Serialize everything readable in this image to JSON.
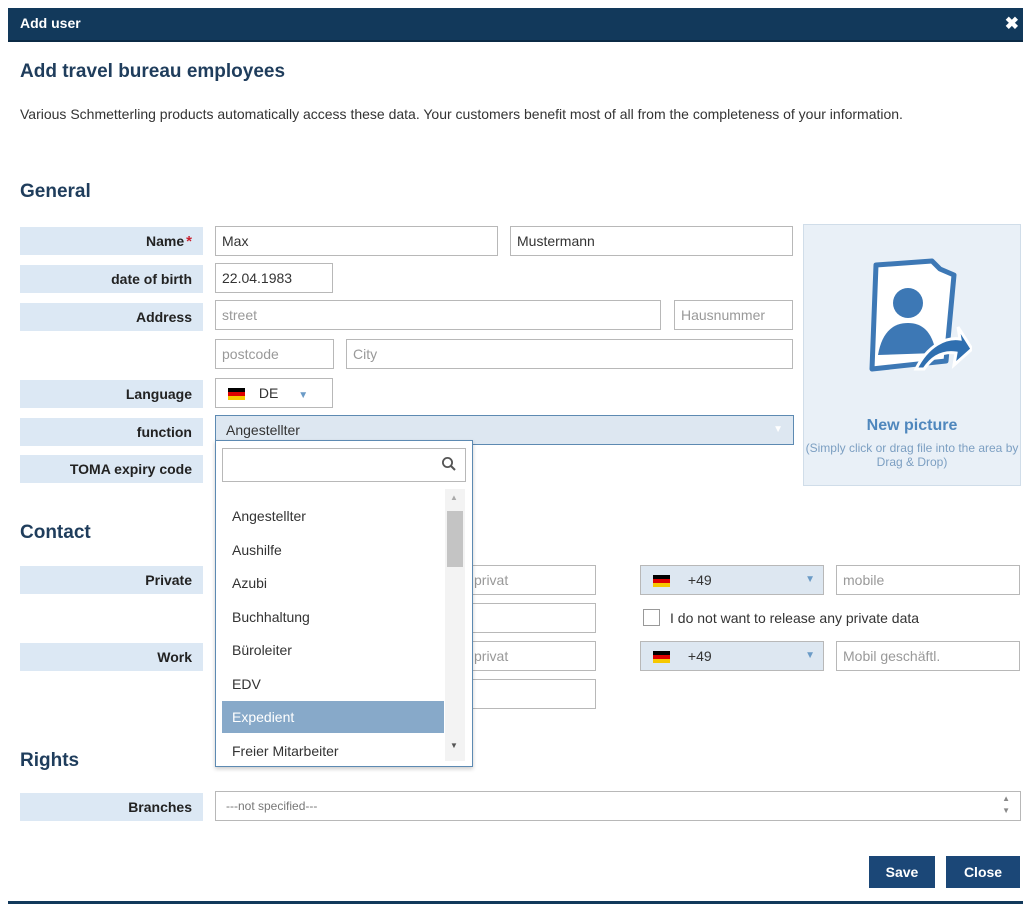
{
  "dialog": {
    "title": "Add user",
    "close_glyph": "✖"
  },
  "page": {
    "heading": "Add travel bureau employees",
    "description": "Various Schmetterling products automatically access these data. Your customers benefit most of all from the completeness of your information."
  },
  "general": {
    "heading": "General",
    "name": {
      "label": "Name",
      "required_mark": "*",
      "first": "Max",
      "last": "Mustermann"
    },
    "dob": {
      "label": "date of birth",
      "value": "22.04.1983"
    },
    "address": {
      "label": "Address",
      "street_placeholder": "street",
      "number_placeholder": "Hausnummer",
      "postcode_placeholder": "postcode",
      "city_placeholder": "City"
    },
    "language": {
      "label": "Language",
      "value": "DE"
    },
    "function": {
      "label": "function",
      "value": "Angestellter"
    },
    "toma": {
      "label": "TOMA expiry code"
    }
  },
  "picture": {
    "title": "New picture",
    "subtitle": "(Simply click or drag file into the area by Drag & Drop)"
  },
  "function_dropdown": {
    "search_value": "",
    "options": [
      "Angestellter",
      "Aushilfe",
      "Azubi",
      "Buchhaltung",
      "Büroleiter",
      "EDV",
      "Expedient",
      "Freier Mitarbeiter"
    ],
    "selected": "Expedient"
  },
  "contact": {
    "heading": "Contact",
    "private": {
      "label": "Private",
      "phone_placeholder": "privat",
      "country_code": "+49",
      "mobile_placeholder": "mobile"
    },
    "no_private_label": "I do not want to release any private data",
    "work": {
      "label": "Work",
      "phone_placeholder": "privat",
      "country_code": "+49",
      "mobile_placeholder": "Mobil geschäftl."
    }
  },
  "rights": {
    "heading": "Rights",
    "branches": {
      "label": "Branches",
      "value": "---not specified---"
    }
  },
  "buttons": {
    "save": "Save",
    "close": "Close"
  },
  "colors": {
    "accent": "#1b4777",
    "label_bg": "#dce8f4",
    "required": "#c8202f"
  }
}
